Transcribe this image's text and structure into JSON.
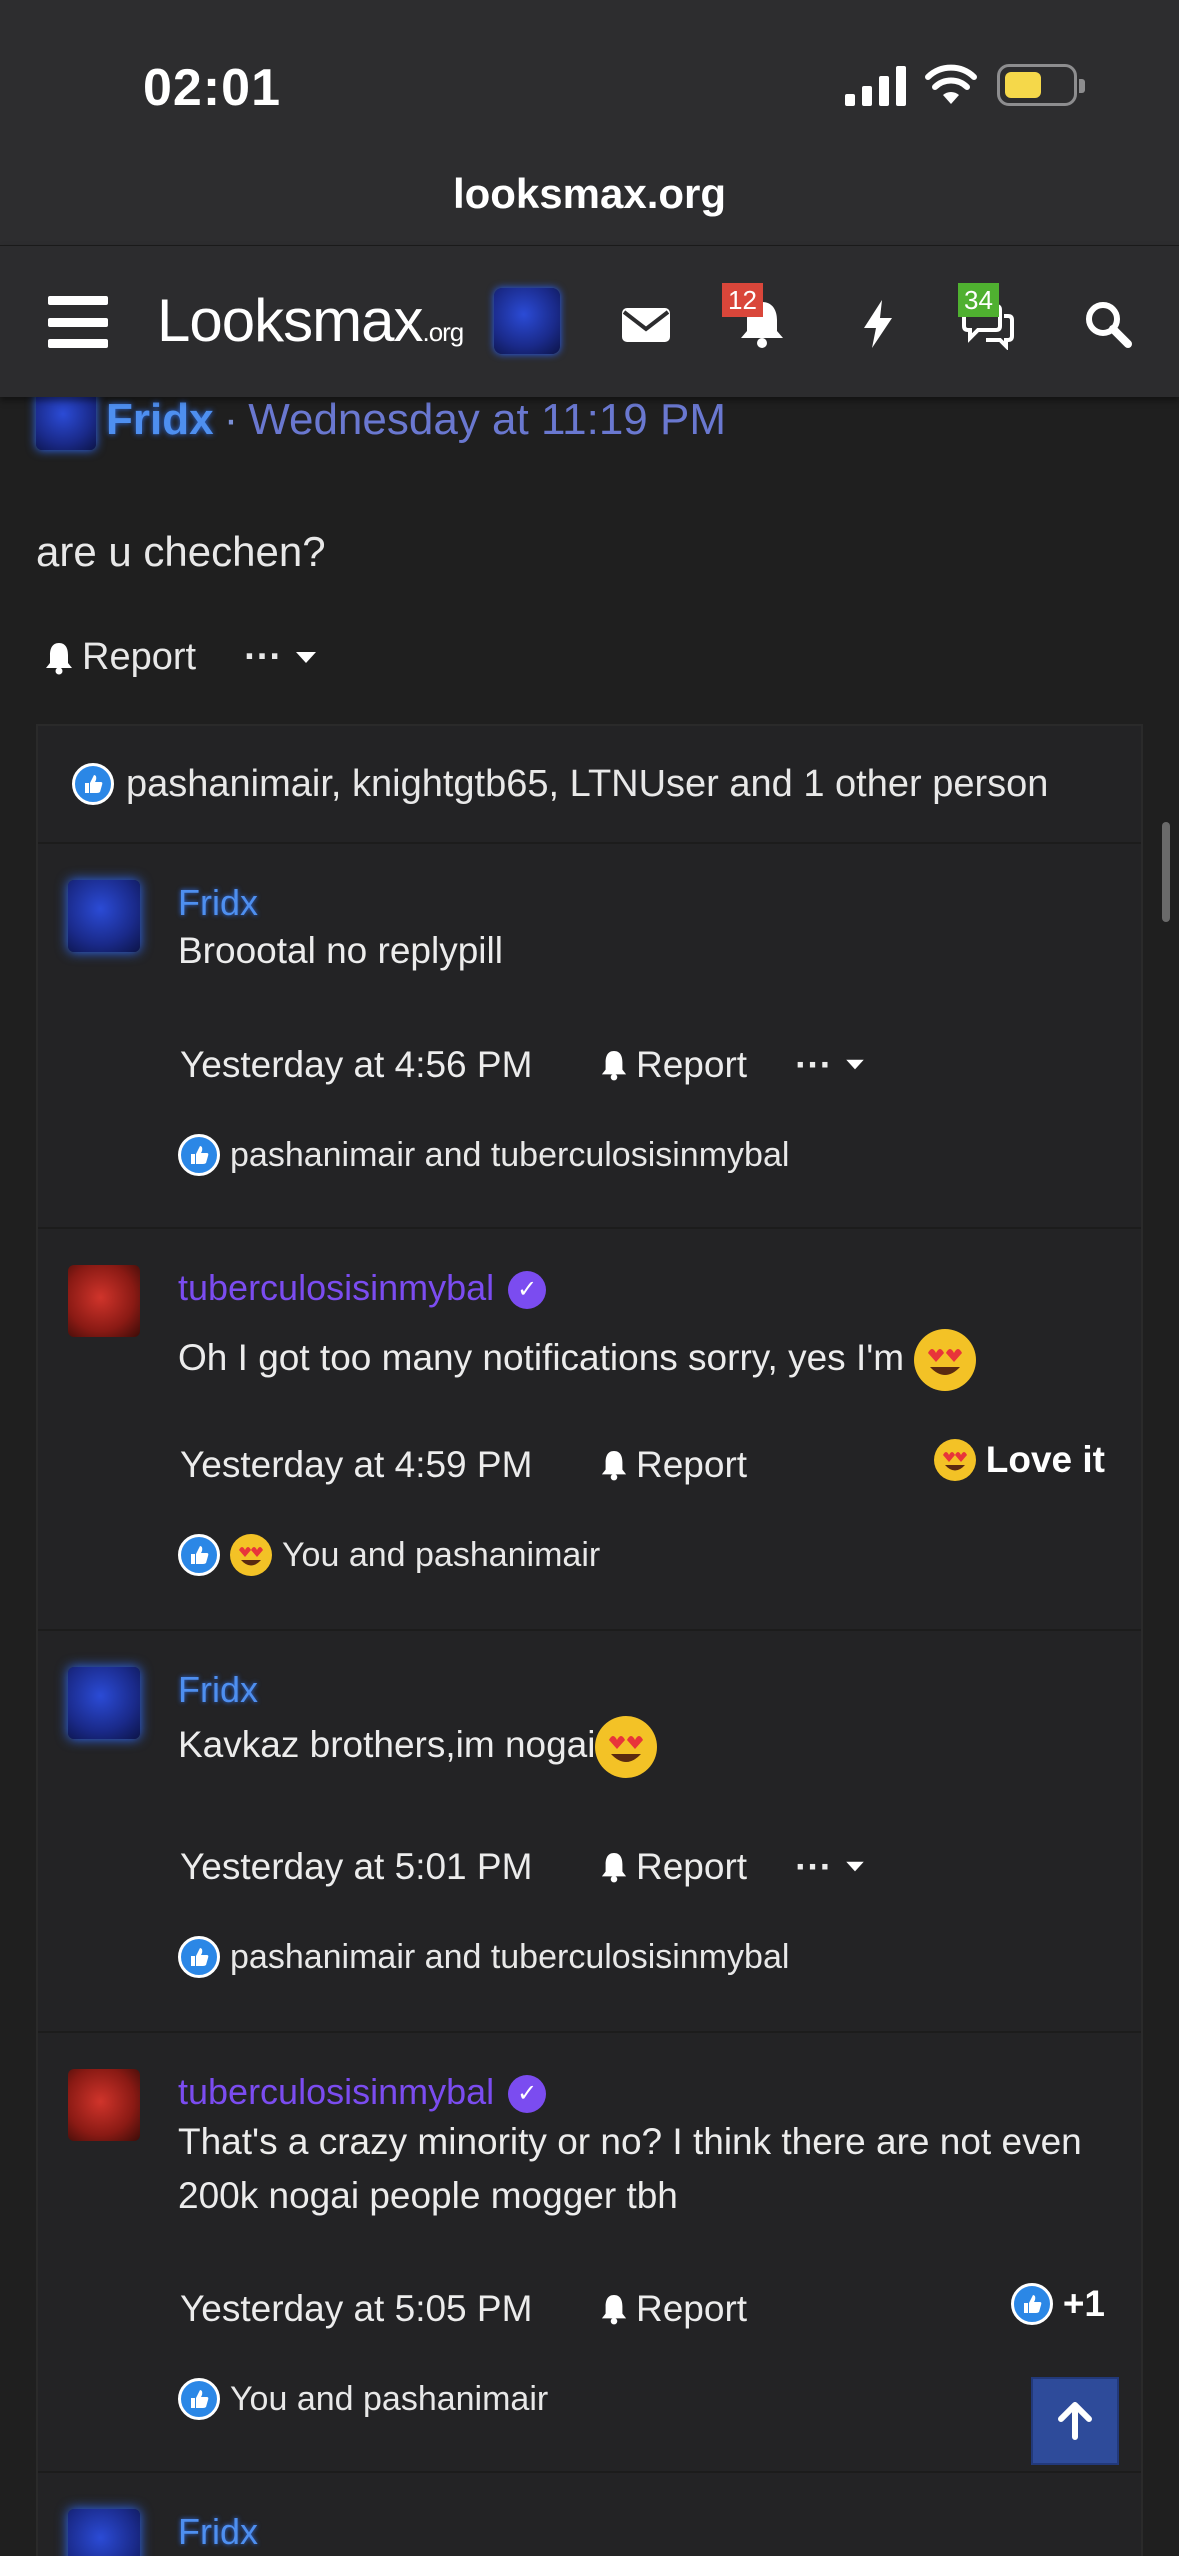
{
  "status_bar": {
    "time": "02:01"
  },
  "browser": {
    "url": "looksmax.org"
  },
  "header": {
    "logo_main": "Looksmax",
    "logo_suffix": ".org",
    "notifications_badge": "12",
    "conversations_badge": "34",
    "colors": {
      "notif_badge": "#d9463a",
      "conv_badge": "#4fb030"
    }
  },
  "post": {
    "author": "Fridx",
    "separator": "·",
    "date": "Wednesday at 11:19 PM",
    "body": "are u chechen?",
    "report_label": "Report",
    "likes_summary": "pashanimair, knightgtb65, LTNUser and 1 other person"
  },
  "replies": [
    {
      "author": "Fridx",
      "text": "Broootal no replypill",
      "date": "Yesterday at 4:56 PM",
      "report_label": "Report",
      "likes": "pashanimair and tuberculosisinmybal"
    },
    {
      "author": "tuberculosisinmybal",
      "text": "Oh I got too many notifications sorry, yes I'm",
      "date": "Yesterday at 4:59 PM",
      "report_label": "Report",
      "reaction_label": "Love it",
      "likes": "You and pashanimair"
    },
    {
      "author": "Fridx",
      "text": "Kavkaz brothers,im nogai",
      "date": "Yesterday at 5:01 PM",
      "report_label": "Report",
      "likes": "pashanimair and tuberculosisinmybal"
    },
    {
      "author": "tuberculosisinmybal",
      "text": "That's a crazy minority or no? I think there are not even 200k nogai people mogger tbh",
      "date": "Yesterday at 5:05 PM",
      "report_label": "Report",
      "reaction_count": "+1",
      "likes": "You and pashanimair"
    },
    {
      "author": "Fridx"
    }
  ]
}
